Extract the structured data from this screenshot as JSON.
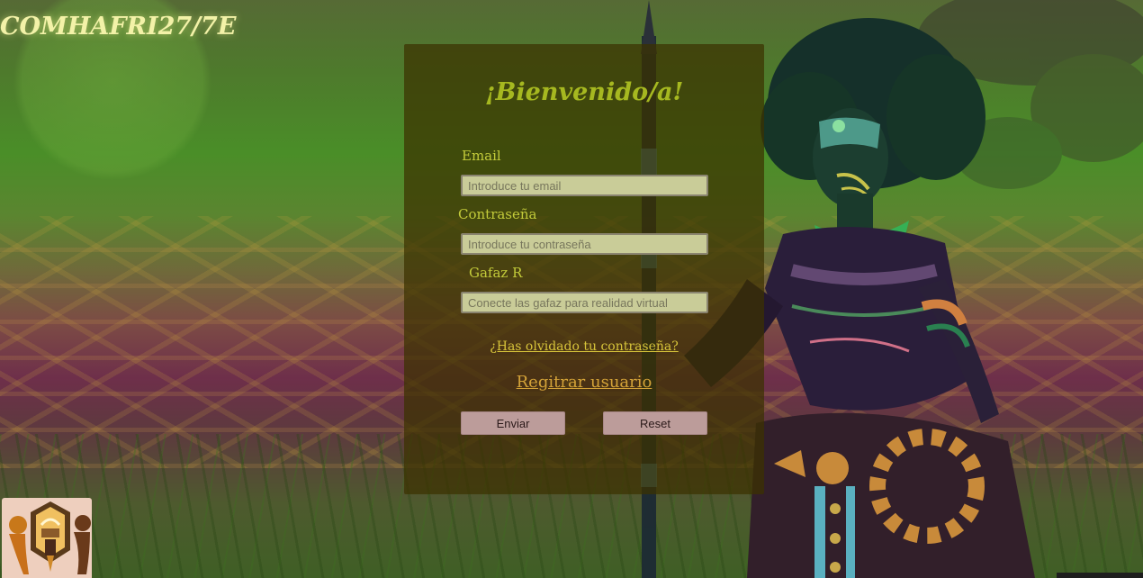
{
  "site": {
    "title": "COMHAFRI27/7E"
  },
  "login": {
    "heading": "¡Bienvenido/a!",
    "email_label": "Email",
    "email_placeholder": "Introduce tu email",
    "password_label": "Contraseña",
    "password_placeholder": "Introduce tu contraseña",
    "vr_label": "Gafaz R",
    "vr_placeholder": "Conecte las gafaz para realidad virtual",
    "forgot_link": "¿Has olvidado tu contraseña?",
    "register_link": "Regitrar usuario",
    "submit_label": "Enviar",
    "reset_label": "Reset"
  },
  "colors": {
    "title": "#f3f2a8",
    "heading": "#a6b820",
    "labels": "#c3cb3a",
    "forgot_link": "#d7c43a",
    "register_link": "#d3a238",
    "buttons": "#bc9c9a",
    "panel": "#3c3200"
  },
  "icons": {
    "logo": "tribal-emblem-logo"
  }
}
